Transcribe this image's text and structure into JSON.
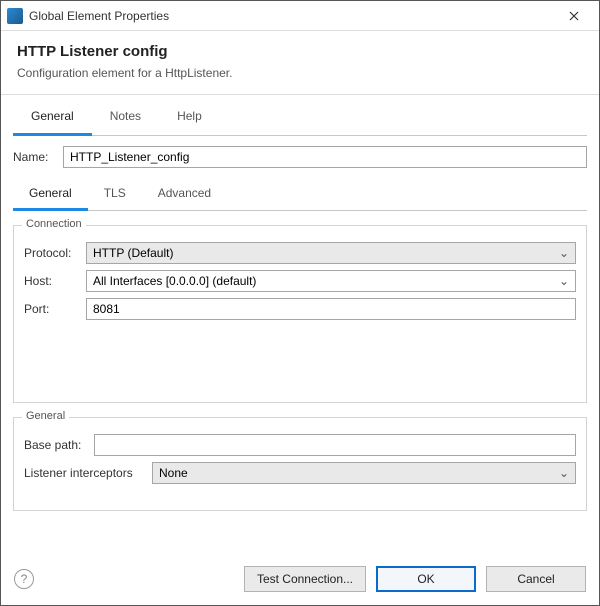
{
  "window": {
    "title": "Global Element Properties"
  },
  "header": {
    "title": "HTTP Listener config",
    "subtitle": "Configuration element for a HttpListener."
  },
  "tabs_top": [
    {
      "label": "General",
      "active": true
    },
    {
      "label": "Notes",
      "active": false
    },
    {
      "label": "Help",
      "active": false
    }
  ],
  "name_field": {
    "label": "Name:",
    "value": "HTTP_Listener_config"
  },
  "tabs_inner": [
    {
      "label": "General",
      "active": true
    },
    {
      "label": "TLS",
      "active": false
    },
    {
      "label": "Advanced",
      "active": false
    }
  ],
  "connection": {
    "legend": "Connection",
    "protocol_label": "Protocol:",
    "protocol_value": "HTTP (Default)",
    "host_label": "Host:",
    "host_value": "All Interfaces [0.0.0.0] (default)",
    "port_label": "Port:",
    "port_value": "8081"
  },
  "general_group": {
    "legend": "General",
    "basepath_label": "Base path:",
    "basepath_value": "",
    "interceptors_label": "Listener interceptors",
    "interceptors_value": "None"
  },
  "footer": {
    "test": "Test Connection...",
    "ok": "OK",
    "cancel": "Cancel",
    "help_char": "?"
  }
}
